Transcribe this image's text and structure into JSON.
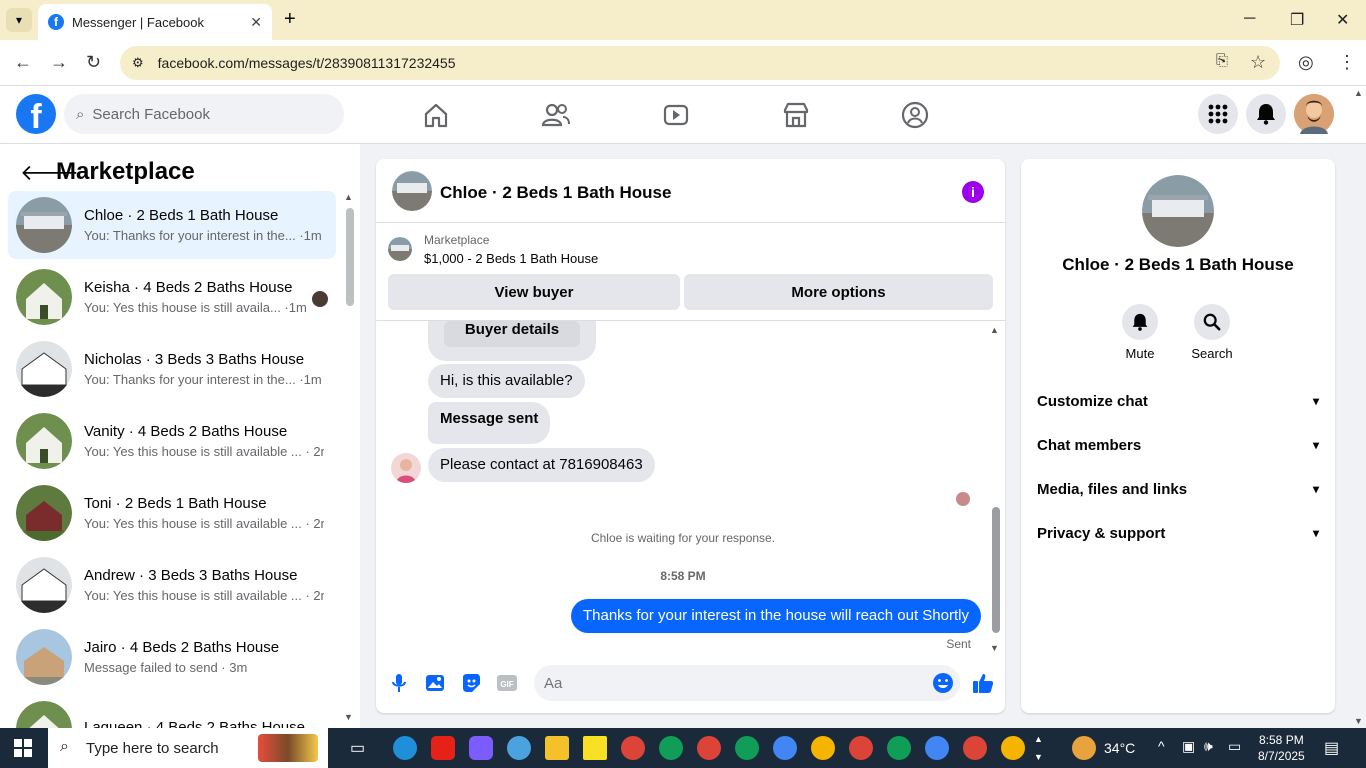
{
  "browser": {
    "tab_title": "Messenger | Facebook",
    "url": "facebook.com/messages/t/28390811317232455"
  },
  "header": {
    "search_placeholder": "Search Facebook"
  },
  "left": {
    "title": "Marketplace",
    "conversations": [
      {
        "name": "Chloe · 2 Beds 1 Bath House",
        "preview": "You: Thanks for your interest in the... ·1m"
      },
      {
        "name": "Keisha · 4 Beds 2 Baths House",
        "preview": "You: Yes this house is still availa... ·1m"
      },
      {
        "name": "Nicholas · 3 Beds 3 Baths House",
        "preview": "You: Thanks for your interest in the... ·1m"
      },
      {
        "name": "Vanity · 4 Beds 2 Baths House",
        "preview": "You: Yes this house is still available ... · 2m"
      },
      {
        "name": "Toni · 2 Beds 1 Bath House",
        "preview": "You: Yes this house is still available ... · 2m"
      },
      {
        "name": "Andrew · 3 Beds 3 Baths House",
        "preview": "You: Yes this house is still available ... · 2m"
      },
      {
        "name": "Jairo · 4 Beds 2 Baths House",
        "preview": "Message failed to send · 3m"
      },
      {
        "name": "Laqueen · 4 Beds 2 Baths House",
        "preview": ""
      }
    ]
  },
  "chat": {
    "title": "Chloe · 2 Beds 1 Bath House",
    "marketplace_label": "Marketplace",
    "listing": "$1,000 - 2 Beds 1 Bath House",
    "view_buyer": "View buyer",
    "more_options": "More options",
    "buyer_details": "Buyer details",
    "messages": [
      "Hi, is this available?",
      "Message sent",
      "Please contact at 7816908463"
    ],
    "waiting_note": "Chloe is waiting for your response.",
    "timestamp": "8:58 PM",
    "sent_message": "Thanks for your interest in the house will reach out Shortly",
    "sent_status": "Sent",
    "input_placeholder": "Aa"
  },
  "right": {
    "title": "Chloe · 2 Beds 1 Bath House",
    "mute": "Mute",
    "search": "Search",
    "sections": [
      "Customize chat",
      "Chat members",
      "Media, files and links",
      "Privacy & support"
    ]
  },
  "taskbar": {
    "search_placeholder": "Type here to search",
    "weather": "34°C",
    "time": "8:58 PM",
    "date": "8/7/2025"
  },
  "colors": {
    "facebook_blue": "#1877f2",
    "messenger_blue": "#0866ff",
    "active_row": "#e7f3ff",
    "info_purple": "#9b00e8"
  }
}
